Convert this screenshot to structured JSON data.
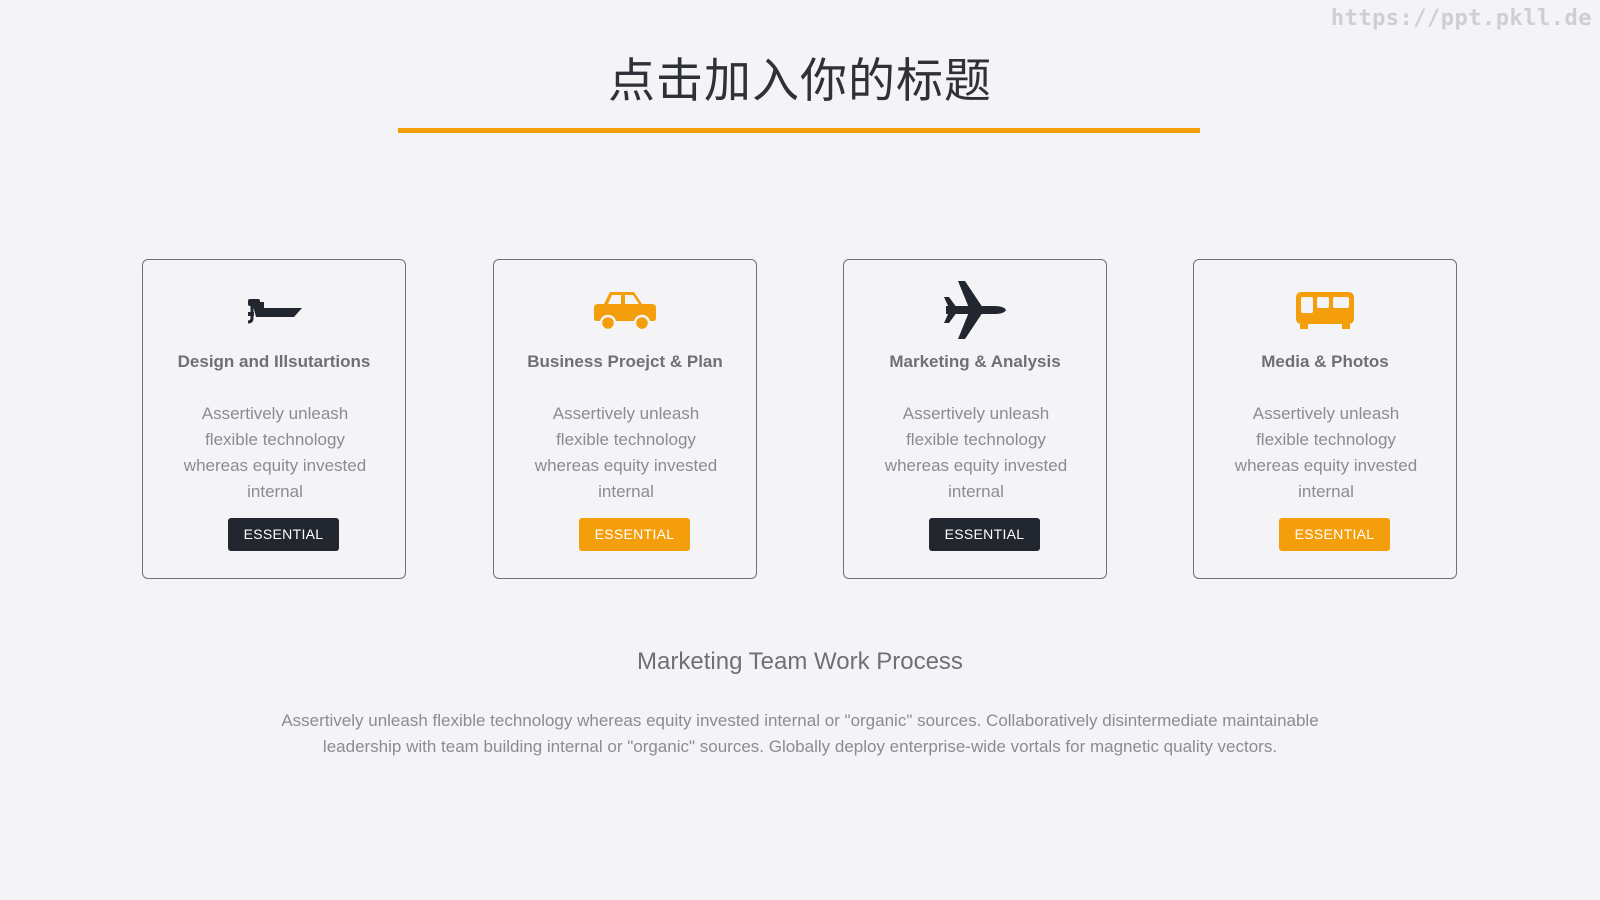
{
  "watermark": "https://ppt.pkll.de",
  "title": "点击加入你的标题",
  "colors": {
    "accent": "#f59e0b",
    "dark": "#22262f",
    "background": "#f4f4f6"
  },
  "cards": [
    {
      "icon": "boat-icon",
      "icon_color": "#22262f",
      "title": "Design and Illsutartions",
      "description": "Assertively unleash flexible technology whereas equity invested internal",
      "badge": "ESSENTIAL",
      "badge_style": "dark"
    },
    {
      "icon": "car-icon",
      "icon_color": "#f59e0b",
      "title": "Business Proejct & Plan",
      "description": "Assertively unleash flexible technology whereas equity invested internal",
      "badge": "ESSENTIAL",
      "badge_style": "orange"
    },
    {
      "icon": "airplane-icon",
      "icon_color": "#22262f",
      "title": "Marketing & Analysis",
      "description": "Assertively unleash flexible technology whereas equity invested internal",
      "badge": "ESSENTIAL",
      "badge_style": "dark"
    },
    {
      "icon": "bus-icon",
      "icon_color": "#f59e0b",
      "title": "Media & Photos",
      "description": "Assertively unleash flexible technology whereas equity invested internal",
      "badge": "ESSENTIAL",
      "badge_style": "orange"
    }
  ],
  "subtitle": "Marketing Team Work Process",
  "paragraph": "Assertively unleash flexible technology whereas equity invested internal or \"organic\" sources. Collaboratively disintermediate maintainable leadership with team building internal or \"organic\" sources. Globally deploy enterprise-wide vortals for magnetic quality vectors."
}
